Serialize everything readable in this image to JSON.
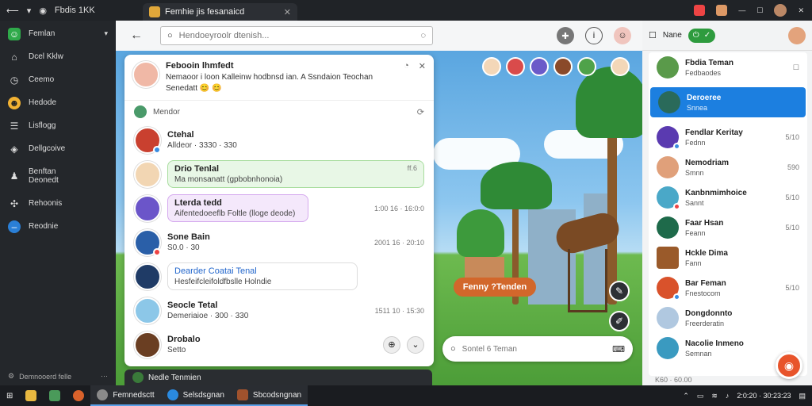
{
  "titlebar": {
    "app_title": "Fbdis 1KK",
    "tab_label": "Femhie jis fesanaicd"
  },
  "sidebar": {
    "items": [
      {
        "label": "Femlan",
        "icon": "chat-icon"
      },
      {
        "label": "Dcel Kklw",
        "icon": "home-icon"
      },
      {
        "label": "Ceemo",
        "icon": "clock-icon"
      },
      {
        "label": "Hedode",
        "icon": "emoji-icon"
      },
      {
        "label": "Lisflogg",
        "icon": "list-icon"
      },
      {
        "label": "Dellgcoive",
        "icon": "gamepad-icon"
      },
      {
        "label": "Benftan Deonedt",
        "icon": "profile-icon"
      },
      {
        "label": "Rehoonis",
        "icon": "friends-icon"
      },
      {
        "label": "Reodnie",
        "icon": "status-icon"
      }
    ],
    "footer": "Demnooerd felle"
  },
  "header": {
    "search_placeholder": "Hendoeyroolr dtenish..."
  },
  "chat": {
    "head": {
      "title": "Febooin lhmfedt",
      "line2": "Nemaoor i loon Kalleinw hodbnsd ian. A Ssndaion Teochan",
      "line3": "Senedatt"
    },
    "subhead": "Mendor",
    "messages": [
      {
        "name": "Ctehal",
        "text": "Alldeor · 3330 · 330",
        "time": ""
      },
      {
        "name": "Drio Tenlal",
        "text": "Ma monsanatt (gpbobnhonoia)",
        "time": "ff.6"
      },
      {
        "name": "Lterda tedd",
        "text": "Aifentedoeeflb Foltle (lloge deode)",
        "time": "1:00 16 · 16:0:0"
      },
      {
        "name": "Sone Bain",
        "text": "S0.0 · 30",
        "time": "2001 16 · 20:10"
      },
      {
        "name": "Dearder Coatai Tenal",
        "text": "Hesfeifcleifoldfbslle Holndie",
        "time": ""
      },
      {
        "name": "Seocle Tetal",
        "text": "Demeriaioe · 300 · 330",
        "time": "1511 10 · 15:30"
      },
      {
        "name": "Drobalo",
        "text": "Setto",
        "time": ""
      }
    ]
  },
  "scene": {
    "sign": "Fenny ?Tenden",
    "search_placeholder": "Sontel 6 Teman",
    "bottom_chat": "Nedle Tenmien"
  },
  "right": {
    "head_label": "Nane",
    "items": [
      {
        "name": "Fbdia Teman",
        "sub": "Fedbaodes",
        "time": ""
      },
      {
        "name": "Deroeree",
        "sub": "Snnea",
        "time": ""
      },
      {
        "name": "Fendlar Keritay",
        "sub": "Fednn",
        "time": "5/10"
      },
      {
        "name": "Nemodriam",
        "sub": "Smnn",
        "time": "590"
      },
      {
        "name": "Kanbnmimhoice",
        "sub": "Sannt",
        "time": "5/10"
      },
      {
        "name": "Faar Hsan",
        "sub": "Feann",
        "time": "5/10"
      },
      {
        "name": "Hckle Dima",
        "sub": "Fann",
        "time": ""
      },
      {
        "name": "Bar Feman",
        "sub": "Fnestocom",
        "time": "5/10"
      },
      {
        "name": "Dongdonnto",
        "sub": "Freerderatin",
        "time": ""
      },
      {
        "name": "Nacolie Inmeno",
        "sub": "Semnan",
        "time": ""
      }
    ],
    "footer": "K60 · 60.00"
  },
  "taskbar": {
    "apps": [
      "Femnedsctt",
      "Selsdsgnan",
      "Sbcodsngnan"
    ],
    "clock": "2:0:20 · 30:23:23"
  },
  "colors": {
    "accent": "#2e9b3e",
    "selected": "#1c7fe0",
    "fab": "#e8542b"
  }
}
